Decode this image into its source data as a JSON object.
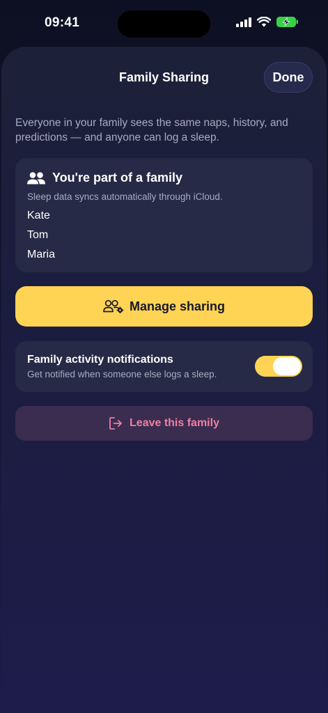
{
  "status_bar": {
    "time": "09:41",
    "icons": [
      "cellular-signal-icon",
      "wifi-icon",
      "battery-charging-icon"
    ]
  },
  "header": {
    "title": "Family Sharing",
    "done_label": "Done"
  },
  "description": "Everyone in your family sees the same naps, history, and predictions — and anyone can log a sleep.",
  "family_card": {
    "icon": "people-icon",
    "title": "You're part of a family",
    "subtitle": "Sleep data syncs automatically through iCloud.",
    "members": [
      "Kate",
      "Tom",
      "Maria"
    ]
  },
  "manage_button": {
    "icon": "people-settings-icon",
    "label": "Manage sharing"
  },
  "notifications": {
    "title": "Family activity notifications",
    "subtitle": "Get notified when someone else logs a sleep.",
    "enabled": true
  },
  "leave_button": {
    "icon": "leave-door-icon",
    "label": "Leave this family"
  },
  "colors": {
    "accent": "#ffd454",
    "destructive_text": "#f07fa4",
    "card_background": "#262a46",
    "background": "#1b1d3f"
  }
}
